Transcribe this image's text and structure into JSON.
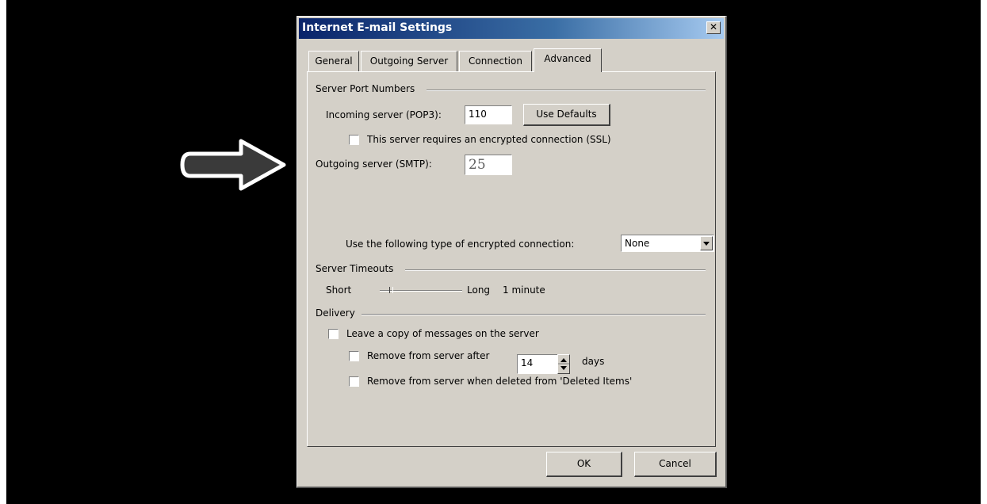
{
  "dialog": {
    "title": "Internet E-mail Settings",
    "close_glyph": "✕"
  },
  "tabs": [
    {
      "label": "General",
      "active": false
    },
    {
      "label": "Outgoing Server",
      "active": false
    },
    {
      "label": "Connection",
      "active": false
    },
    {
      "label": "Advanced",
      "active": true
    }
  ],
  "server_ports": {
    "heading": "Server Port Numbers",
    "incoming_label": "Incoming server (POP3):",
    "incoming_value": "110",
    "use_defaults_label": "Use Defaults",
    "ssl_label": "This server requires an encrypted connection (SSL)",
    "ssl_checked": false,
    "outgoing_label": "Outgoing server (SMTP):",
    "outgoing_value": "25",
    "encryption_label": "Use the following type of encrypted connection:",
    "encryption_value": "None"
  },
  "timeouts": {
    "heading": "Server Timeouts",
    "short_label": "Short",
    "long_label": "Long",
    "value_label": "1 minute",
    "slider_level": 0.12
  },
  "delivery": {
    "heading": "Delivery",
    "leave_copy_label": "Leave a copy of messages on the server",
    "leave_copy_checked": false,
    "remove_after_label": "Remove from server after",
    "remove_after_days": "14",
    "days_label": "days",
    "remove_deleted_label": "Remove from server when deleted from 'Deleted Items'"
  },
  "buttons": {
    "ok_label": "OK",
    "cancel_label": "Cancel"
  },
  "icons": [
    "right-arrow-pointer-icon",
    "close-icon",
    "dropdown-arrow-icon",
    "spinner-up-icon",
    "spinner-down-icon"
  ],
  "colors": {
    "background": "#000000",
    "dialog_face": "#d4d0c8",
    "titlebar_start": "#0a246a",
    "titlebar_end": "#a6caf0"
  }
}
